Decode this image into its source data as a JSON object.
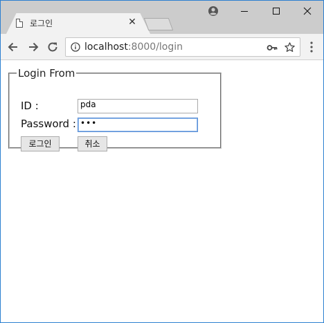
{
  "tab": {
    "title": "로그인"
  },
  "address": {
    "host": "localhost",
    "rest": ":8000/login"
  },
  "form": {
    "legend": "Login From",
    "id_label": "ID :",
    "password_label": "Password :",
    "id_value": "pda",
    "password_value": "•••",
    "login_button": "로그인",
    "cancel_button": "취소"
  },
  "icons": {
    "tab": "document-icon",
    "back": "arrow-left-icon",
    "forward": "arrow-right-icon",
    "reload": "reload-icon",
    "info": "info-icon",
    "key": "key-icon",
    "bookmark": "star-icon",
    "menu": "kebab-menu-icon",
    "profile": "profile-icon"
  },
  "colors": {
    "accent": "#2b7fd0",
    "chrome": "#cccccc",
    "toolbar": "#f2f2f2"
  }
}
